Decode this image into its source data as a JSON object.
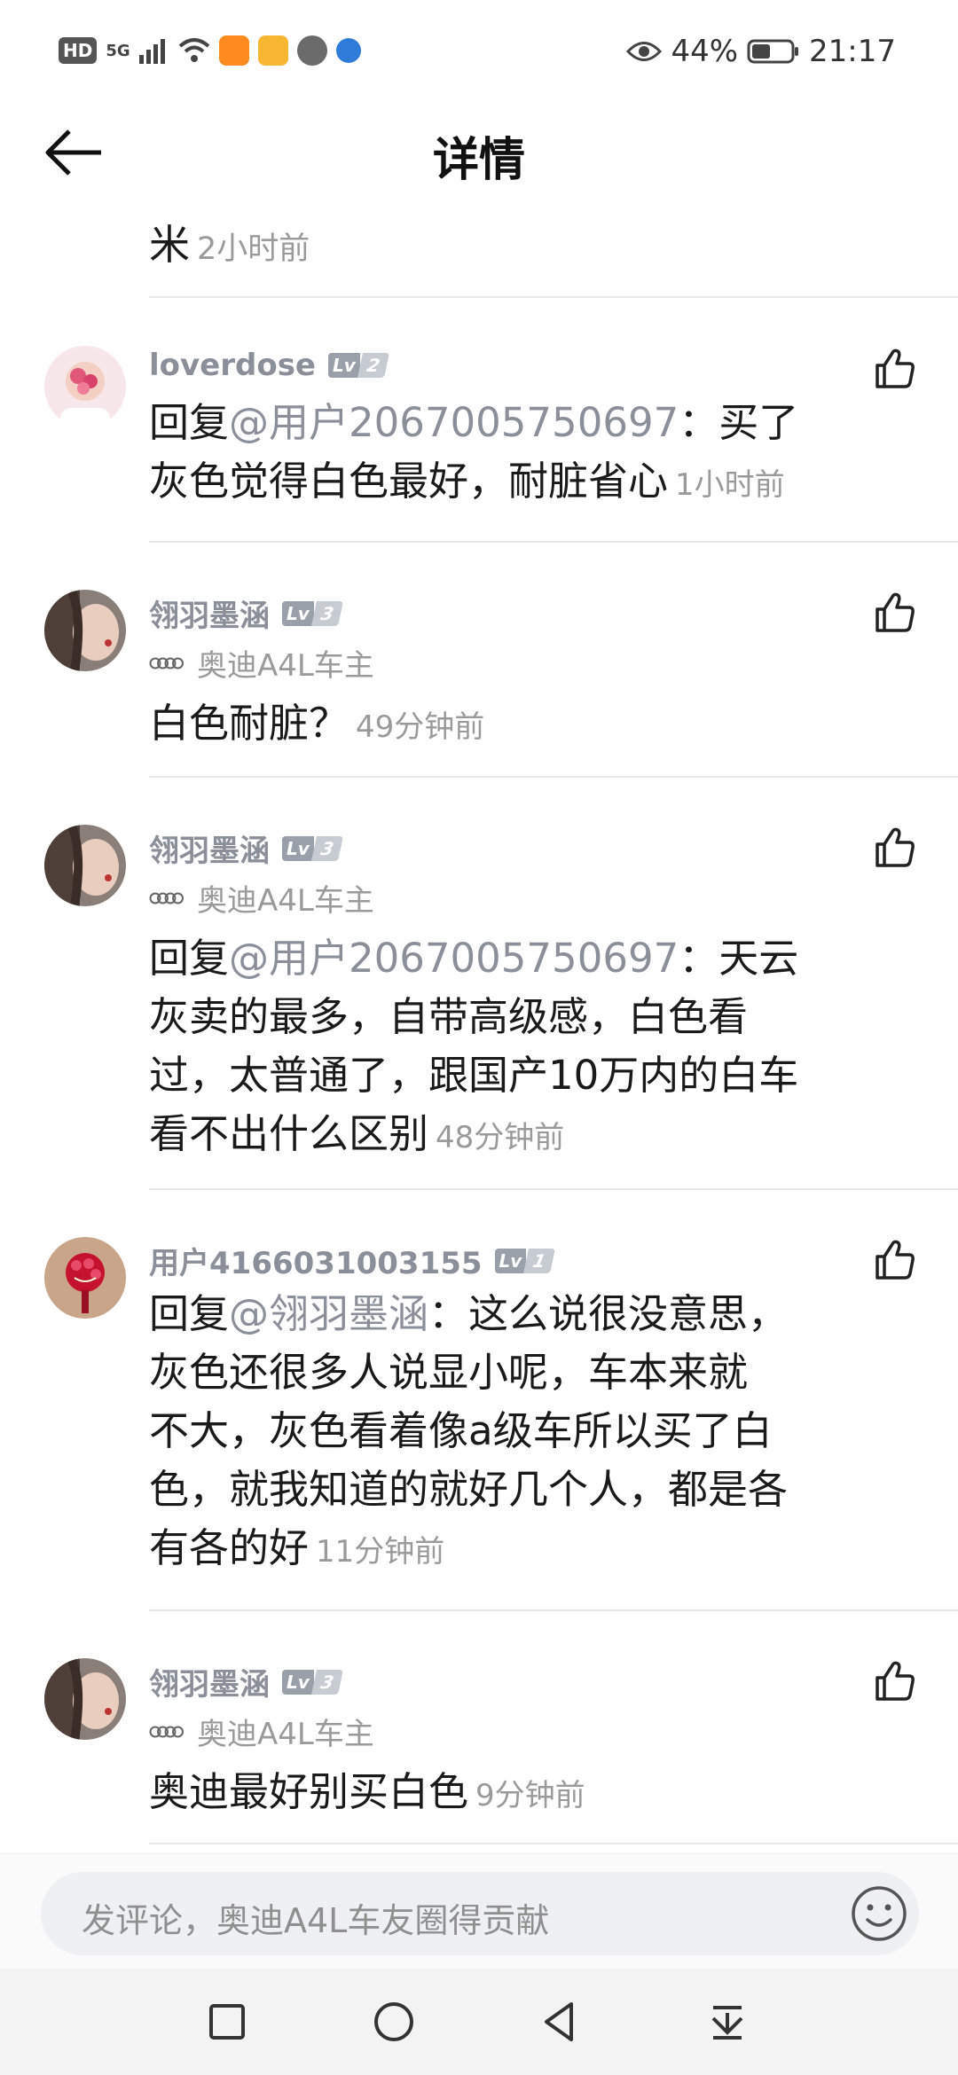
{
  "status_bar": {
    "hd": "HD",
    "network": "5G",
    "battery": "44%",
    "time": "21:17"
  },
  "header": {
    "title": "详情"
  },
  "top_snippet": {
    "text": "米",
    "time": "2小时前"
  },
  "comments": [
    {
      "name": "loverdose",
      "level": "2",
      "owner": "",
      "reply_prefix": "回复",
      "reply_to": "@用户2067005750697",
      "text_line1": "：买了",
      "text_rest": "灰色觉得白色最好，耐脏省心",
      "time": "1小时前"
    },
    {
      "name": "翎羽墨涵",
      "level": "3",
      "owner": "奥迪A4L车主",
      "text": "白色耐脏？",
      "time": "49分钟前"
    },
    {
      "name": "翎羽墨涵",
      "level": "3",
      "owner": "奥迪A4L车主",
      "reply_prefix": "回复",
      "reply_to": "@用户2067005750697",
      "text_line1": "：天云",
      "lines": [
        "灰卖的最多，自带高级感，白色看",
        "过，太普通了，跟国产10万内的白车"
      ],
      "last": "看不出什么区别",
      "time": "48分钟前"
    },
    {
      "name": "用户4166031003155",
      "level": "1",
      "owner": "",
      "reply_prefix": "回复",
      "reply_to": "@翎羽墨涵",
      "text_line1": "：这么说很没意思，",
      "lines": [
        "灰色还很多人说显小呢，车本来就",
        "不大，灰色看着像a级车所以买了白",
        "色，就我知道的就好几个人，都是各"
      ],
      "last": "有各的好",
      "time": "11分钟前"
    },
    {
      "name": "翎羽墨涵",
      "level": "3",
      "owner": "奥迪A4L车主",
      "text": "奥迪最好别买白色",
      "time": "9分钟前"
    }
  ],
  "composer": {
    "placeholder": "发评论，奥迪A4L车友圈得贡献"
  },
  "lv_prefix": "Lv"
}
